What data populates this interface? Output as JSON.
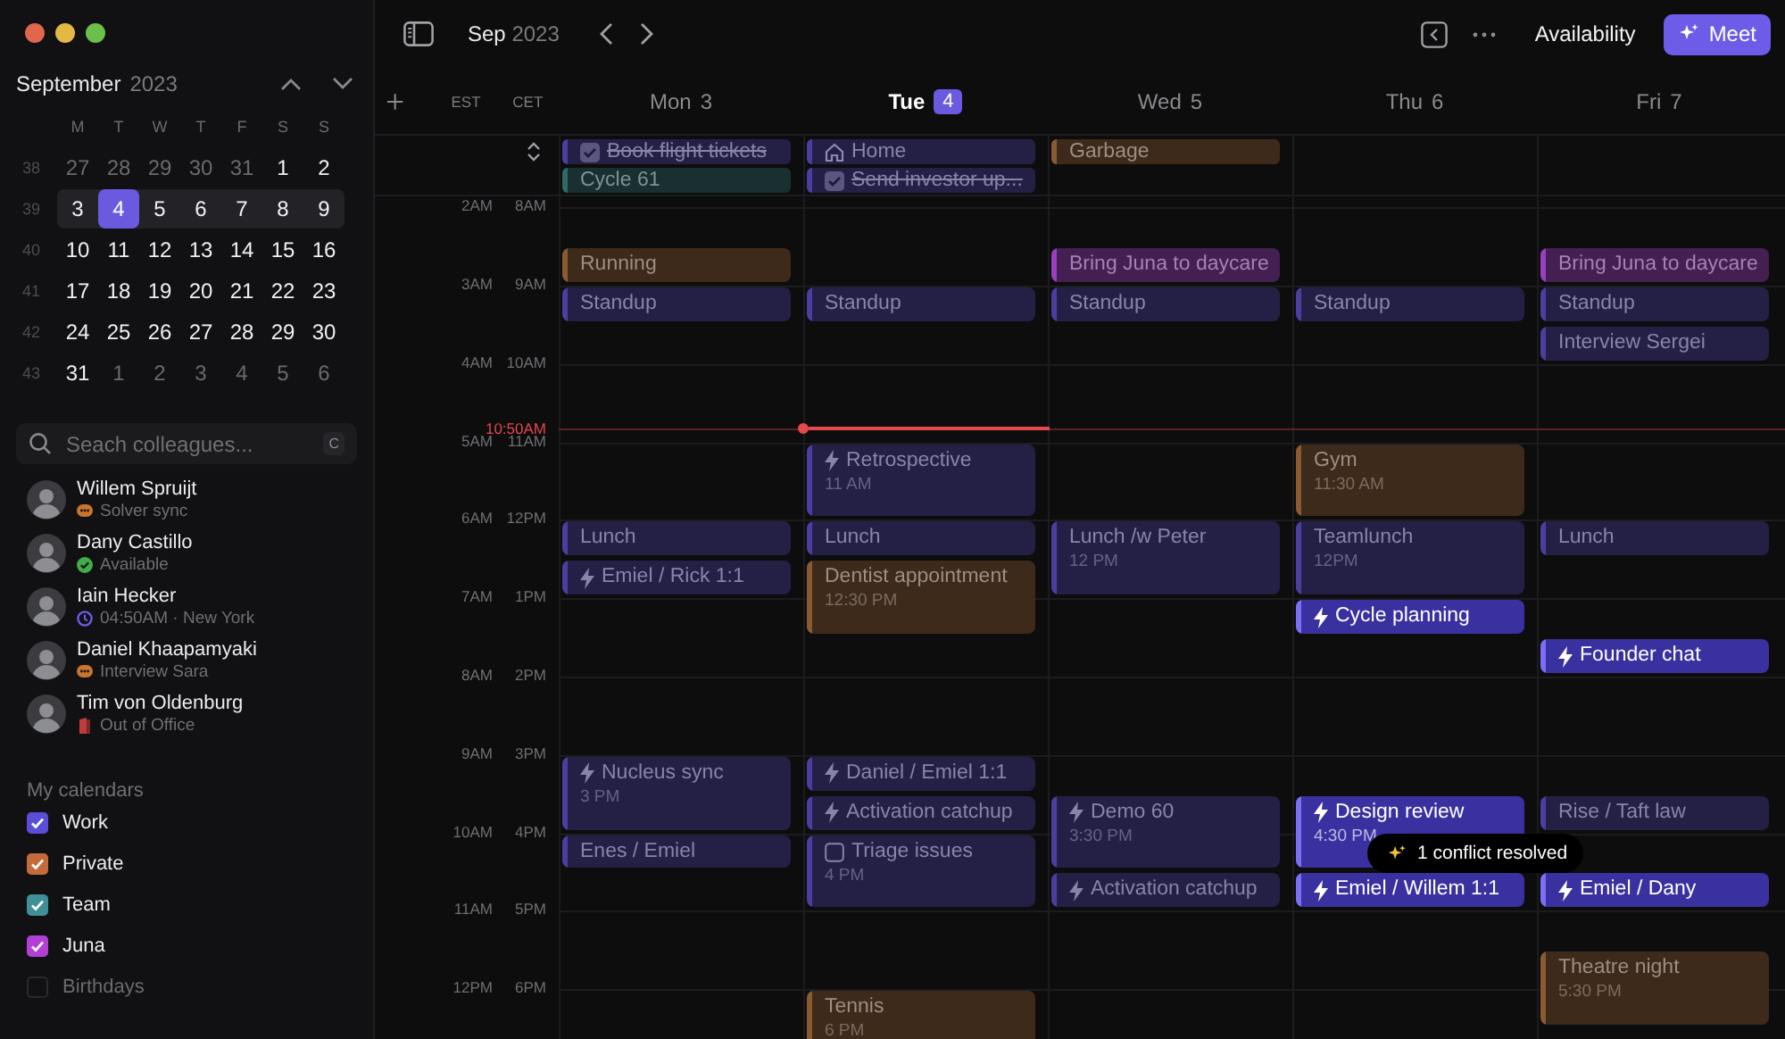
{
  "sidebar": {
    "month": "September",
    "year": "2023",
    "weekdays": [
      "M",
      "T",
      "W",
      "T",
      "F",
      "S",
      "S"
    ],
    "weeks": [
      {
        "number": "38",
        "current": false,
        "days": [
          {
            "label": "27",
            "muted": true,
            "selected": false
          },
          {
            "label": "28",
            "muted": true,
            "selected": false
          },
          {
            "label": "29",
            "muted": true,
            "selected": false
          },
          {
            "label": "30",
            "muted": true,
            "selected": false
          },
          {
            "label": "31",
            "muted": true,
            "selected": false
          },
          {
            "label": "1",
            "muted": false,
            "selected": false
          },
          {
            "label": "2",
            "muted": false,
            "selected": false
          }
        ]
      },
      {
        "number": "39",
        "current": true,
        "days": [
          {
            "label": "3",
            "muted": false,
            "selected": false
          },
          {
            "label": "4",
            "muted": false,
            "selected": true
          },
          {
            "label": "5",
            "muted": false,
            "selected": false
          },
          {
            "label": "6",
            "muted": false,
            "selected": false
          },
          {
            "label": "7",
            "muted": false,
            "selected": false
          },
          {
            "label": "8",
            "muted": false,
            "selected": false
          },
          {
            "label": "9",
            "muted": false,
            "selected": false
          }
        ]
      },
      {
        "number": "40",
        "current": false,
        "days": [
          {
            "label": "10",
            "muted": false,
            "selected": false
          },
          {
            "label": "11",
            "muted": false,
            "selected": false
          },
          {
            "label": "12",
            "muted": false,
            "selected": false
          },
          {
            "label": "13",
            "muted": false,
            "selected": false
          },
          {
            "label": "14",
            "muted": false,
            "selected": false
          },
          {
            "label": "15",
            "muted": false,
            "selected": false
          },
          {
            "label": "16",
            "muted": false,
            "selected": false
          }
        ]
      },
      {
        "number": "41",
        "current": false,
        "days": [
          {
            "label": "17",
            "muted": false,
            "selected": false
          },
          {
            "label": "18",
            "muted": false,
            "selected": false
          },
          {
            "label": "19",
            "muted": false,
            "selected": false
          },
          {
            "label": "20",
            "muted": false,
            "selected": false
          },
          {
            "label": "21",
            "muted": false,
            "selected": false
          },
          {
            "label": "22",
            "muted": false,
            "selected": false
          },
          {
            "label": "23",
            "muted": false,
            "selected": false
          }
        ]
      },
      {
        "number": "42",
        "current": false,
        "days": [
          {
            "label": "24",
            "muted": false,
            "selected": false
          },
          {
            "label": "25",
            "muted": false,
            "selected": false
          },
          {
            "label": "26",
            "muted": false,
            "selected": false
          },
          {
            "label": "27",
            "muted": false,
            "selected": false
          },
          {
            "label": "28",
            "muted": false,
            "selected": false
          },
          {
            "label": "29",
            "muted": false,
            "selected": false
          },
          {
            "label": "30",
            "muted": false,
            "selected": false
          }
        ]
      },
      {
        "number": "43",
        "current": false,
        "days": [
          {
            "label": "31",
            "muted": false,
            "selected": false
          },
          {
            "label": "1",
            "muted": true,
            "selected": false
          },
          {
            "label": "2",
            "muted": true,
            "selected": false
          },
          {
            "label": "3",
            "muted": true,
            "selected": false
          },
          {
            "label": "4",
            "muted": true,
            "selected": false
          },
          {
            "label": "5",
            "muted": true,
            "selected": false
          },
          {
            "label": "6",
            "muted": true,
            "selected": false
          }
        ]
      }
    ],
    "search": {
      "placeholder": "Seach colleagues...",
      "shortcut": "C"
    },
    "colleagues": [
      {
        "name": "Willem Spruijt",
        "status": "Solver sync",
        "kind": "meeting"
      },
      {
        "name": "Dany Castillo",
        "status": "Available",
        "kind": "available"
      },
      {
        "name": "Iain Hecker",
        "status": "04:50AM · New York",
        "kind": "clock"
      },
      {
        "name": "Daniel Khaapamyaki",
        "status": "Interview Sara",
        "kind": "meeting"
      },
      {
        "name": "Tim von Oldenburg",
        "status": "Out of Office",
        "kind": "away"
      }
    ],
    "calendars_title": "My calendars",
    "calendars": [
      {
        "label": "Work",
        "color": "#5b4ed6",
        "checked": true
      },
      {
        "label": "Private",
        "color": "#c46b3a",
        "checked": true
      },
      {
        "label": "Team",
        "color": "#3f8f96",
        "checked": true
      },
      {
        "label": "Juna",
        "color": "#b43fd6",
        "checked": true
      },
      {
        "label": "Birthdays",
        "color": "#2a2a2c",
        "checked": false
      }
    ]
  },
  "toolbar": {
    "month": "Sep",
    "year": "2023",
    "availability": "Availability",
    "meet": "Meet"
  },
  "timezones": [
    "EST",
    "CET"
  ],
  "days": [
    {
      "weekday": "Mon",
      "date": "3",
      "selected": false
    },
    {
      "weekday": "Tue",
      "date": "4",
      "selected": true
    },
    {
      "weekday": "Wed",
      "date": "5",
      "selected": false
    },
    {
      "weekday": "Thu",
      "date": "6",
      "selected": false
    },
    {
      "weekday": "Fri",
      "date": "7",
      "selected": false
    }
  ],
  "all_day": {
    "mon": [
      {
        "title": "Book flight tickets",
        "color": "#4a3fa0",
        "kind": "task",
        "done": true
      },
      {
        "title": "Cycle 61",
        "color": "#2f6a68",
        "kind": "event",
        "done": false
      }
    ],
    "tue": [
      {
        "title": "Home",
        "color": "#4a3fa0",
        "kind": "location",
        "done": false
      },
      {
        "title": "Send investor up...",
        "color": "#4a3fa0",
        "kind": "task",
        "done": true
      }
    ],
    "wed": [
      {
        "title": "Garbage",
        "color": "#8a5a30",
        "kind": "event",
        "done": false
      }
    ]
  },
  "hours": [
    {
      "est": "2AM",
      "cet": "8AM",
      "mon": [
        {
          "title": "Running",
          "color": "#8a5a30",
          "kind": "event",
          "half": true,
          "long": false,
          "bright": false
        }
      ],
      "wed": [
        {
          "title": "Bring Juna to daycare",
          "color": "#9a3fbf",
          "kind": "event",
          "half": true,
          "long": false,
          "bright": false
        }
      ],
      "fri": [
        {
          "title": "Bring Juna to daycare",
          "color": "#9a3fbf",
          "kind": "event",
          "half": true,
          "long": false,
          "bright": false
        }
      ]
    },
    {
      "est": "3AM",
      "cet": "9AM",
      "mon": [
        {
          "title": "Standup",
          "color": "#4a3fa0",
          "kind": "event",
          "half": false,
          "long": false,
          "bright": false
        }
      ],
      "tue": [
        {
          "title": "Standup",
          "color": "#4a3fa0",
          "kind": "event",
          "half": false,
          "long": false,
          "bright": false
        }
      ],
      "wed": [
        {
          "title": "Standup",
          "color": "#4a3fa0",
          "kind": "event",
          "half": false,
          "long": false,
          "bright": false
        }
      ],
      "thu": [
        {
          "title": "Standup",
          "color": "#4a3fa0",
          "kind": "event",
          "half": false,
          "long": false,
          "bright": false
        }
      ],
      "fri": [
        {
          "title": "Standup",
          "color": "#4a3fa0",
          "kind": "event",
          "half": false,
          "long": false,
          "bright": false
        },
        {
          "title": "Interview Sergei",
          "color": "#4a3fa0",
          "kind": "event",
          "half": true,
          "long": false,
          "bright": false
        }
      ]
    },
    {
      "est": "4AM",
      "cet": "10AM"
    },
    {
      "est": "5AM",
      "cet": "11AM",
      "tue": [
        {
          "title": "Retrospective",
          "time": "11 AM",
          "color": "#4a3fa0",
          "kind": "focus",
          "half": false,
          "long": true,
          "bright": false
        }
      ],
      "thu": [
        {
          "title": "Gym",
          "time": "11:30 AM",
          "color": "#8a5a30",
          "kind": "event",
          "half": false,
          "long": true,
          "bright": false
        }
      ]
    },
    {
      "est": "6AM",
      "cet": "12PM",
      "mon": [
        {
          "title": "Lunch",
          "color": "#4a3fa0",
          "kind": "event",
          "half": false,
          "long": false,
          "bright": false
        },
        {
          "title": "Emiel / Rick 1:1",
          "color": "#4a3fa0",
          "kind": "focus",
          "half": true,
          "long": false,
          "bright": false
        }
      ],
      "tue": [
        {
          "title": "Lunch",
          "color": "#4a3fa0",
          "kind": "event",
          "half": false,
          "long": false,
          "bright": false
        },
        {
          "title": "Dentist appointment",
          "time": "12:30 PM",
          "color": "#8a5a30",
          "kind": "event",
          "half": true,
          "long": true,
          "bright": false
        }
      ],
      "wed": [
        {
          "title": "Lunch /w Peter",
          "time": "12 PM",
          "color": "#4a3fa0",
          "kind": "event",
          "half": false,
          "long": true,
          "bright": false
        }
      ],
      "thu": [
        {
          "title": "Teamlunch",
          "time": "12PM",
          "color": "#4a3fa0",
          "kind": "event",
          "half": false,
          "long": true,
          "bright": false
        }
      ],
      "fri": [
        {
          "title": "Lunch",
          "color": "#4a3fa0",
          "kind": "event",
          "half": false,
          "long": false,
          "bright": false
        }
      ]
    },
    {
      "est": "7AM",
      "cet": "1PM",
      "thu": [
        {
          "title": "Cycle planning",
          "color": "#7d6ef7",
          "kind": "focus",
          "half": false,
          "long": false,
          "bright": true
        }
      ],
      "fri": [
        {
          "title": "Founder chat",
          "color": "#7d6ef7",
          "kind": "focus",
          "half": true,
          "long": false,
          "bright": true
        }
      ]
    },
    {
      "est": "8AM",
      "cet": "2PM"
    },
    {
      "est": "9AM",
      "cet": "3PM",
      "mon": [
        {
          "title": "Nucleus sync",
          "time": "3 PM",
          "color": "#4a3fa0",
          "kind": "focus",
          "half": false,
          "long": true,
          "bright": false
        }
      ],
      "tue": [
        {
          "title": "Daniel / Emiel 1:1",
          "color": "#4a3fa0",
          "kind": "focus",
          "half": false,
          "long": false,
          "bright": false
        },
        {
          "title": "Activation catchup",
          "color": "#4a3fa0",
          "kind": "focus",
          "half": true,
          "long": false,
          "bright": false
        }
      ],
      "wed": [
        {
          "title": "Demo 60",
          "time": "3:30 PM",
          "color": "#4a3fa0",
          "kind": "focus",
          "half": true,
          "long": true,
          "bright": false
        }
      ],
      "thu": [
        {
          "title": "Design review",
          "time": "4:30 PM",
          "color": "#7d6ef7",
          "kind": "focus",
          "half": true,
          "long": true,
          "bright": true
        }
      ],
      "fri": [
        {
          "title": "Rise / Taft law",
          "color": "#4a3fa0",
          "kind": "event",
          "half": true,
          "long": false,
          "bright": false
        }
      ]
    },
    {
      "est": "10AM",
      "cet": "4PM",
      "mon": [
        {
          "title": "Enes / Emiel",
          "color": "#4a3fa0",
          "kind": "event",
          "half": false,
          "long": false,
          "bright": false
        }
      ],
      "tue": [
        {
          "title": "Triage issues",
          "time": "4 PM",
          "color": "#4a3fa0",
          "kind": "task",
          "half": false,
          "long": true,
          "bright": false
        }
      ],
      "wed": [
        {
          "title": "Activation catchup",
          "color": "#4a3fa0",
          "kind": "focus",
          "half": true,
          "long": false,
          "bright": false
        }
      ],
      "thu": [
        {
          "title": "Emiel / Willem 1:1",
          "color": "#7d6ef7",
          "kind": "focus",
          "half": true,
          "long": false,
          "bright": true
        }
      ],
      "fri": [
        {
          "title": "Emiel / Dany",
          "color": "#7d6ef7",
          "kind": "focus",
          "half": true,
          "long": false,
          "bright": true
        }
      ]
    },
    {
      "est": "11AM",
      "cet": "5PM",
      "fri": [
        {
          "title": "Theatre night",
          "time": "5:30 PM",
          "color": "#8a5a30",
          "kind": "event",
          "half": true,
          "long": true,
          "bright": false
        }
      ]
    },
    {
      "est": "12PM",
      "cet": "6PM",
      "tue": [
        {
          "title": "Tennis",
          "time": "6 PM",
          "color": "#8a5a30",
          "kind": "event",
          "half": false,
          "long": true,
          "bright": false
        }
      ]
    }
  ],
  "now": {
    "label": "10:50AM"
  },
  "toast": {
    "text": "1 conflict resolved"
  }
}
